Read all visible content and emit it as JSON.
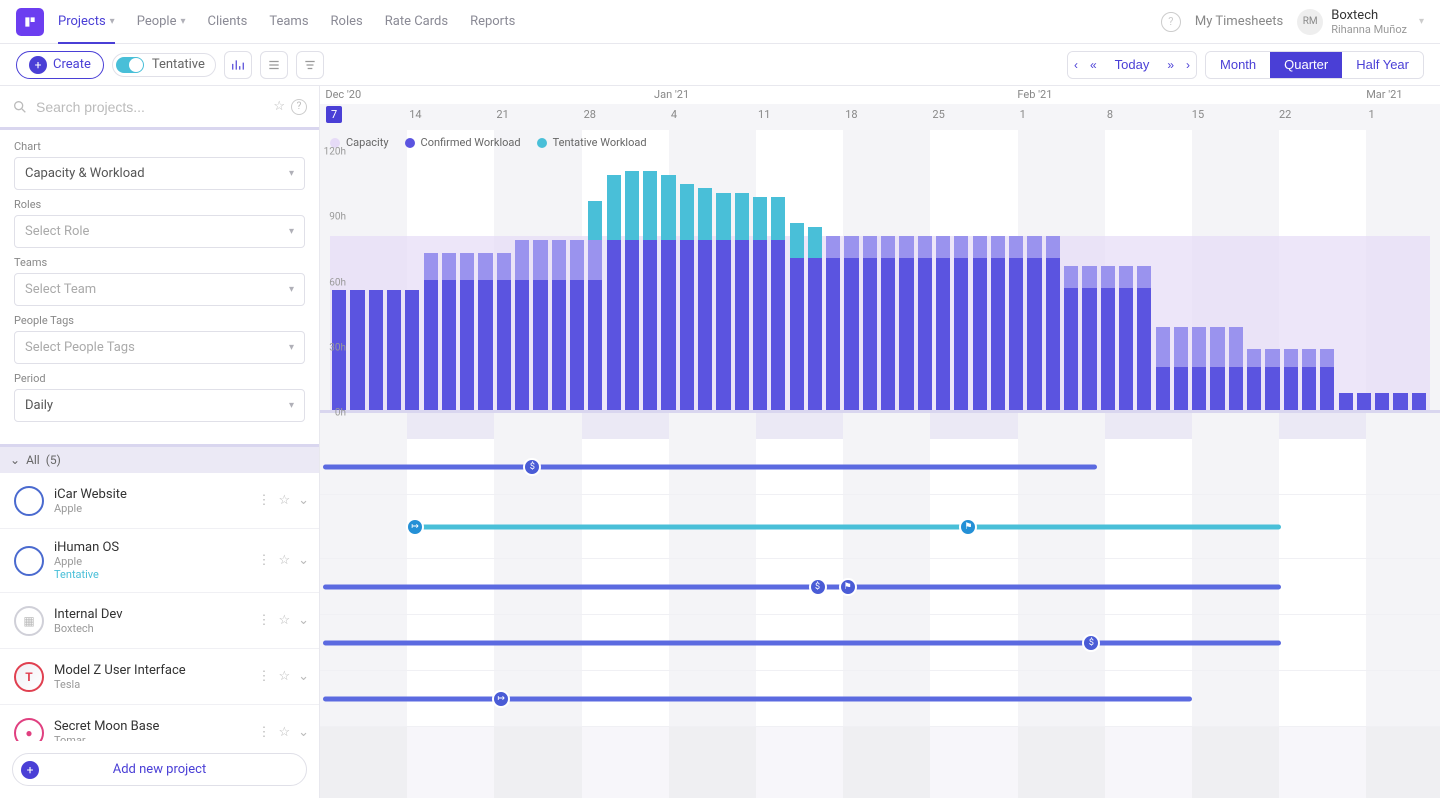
{
  "nav": {
    "tabs": [
      "Projects",
      "People",
      "Clients",
      "Teams",
      "Roles",
      "Rate Cards",
      "Reports"
    ],
    "active": "Projects",
    "my_timesheets": "My Timesheets",
    "company": "Boxtech",
    "user": "Rihanna Muñoz",
    "initials": "RM"
  },
  "toolbar": {
    "create": "Create",
    "tentative": "Tentative",
    "today": "Today",
    "ranges": [
      "Month",
      "Quarter",
      "Half Year"
    ],
    "active_range": "Quarter"
  },
  "search": {
    "placeholder": "Search projects..."
  },
  "filters": {
    "chart_label": "Chart",
    "chart_value": "Capacity & Workload",
    "roles_label": "Roles",
    "roles_placeholder": "Select Role",
    "teams_label": "Teams",
    "teams_placeholder": "Select Team",
    "tags_label": "People Tags",
    "tags_placeholder": "Select People Tags",
    "period_label": "Period",
    "period_value": "Daily"
  },
  "timeline": {
    "months": [
      {
        "label": "Dec '20",
        "pos": 0.003
      },
      {
        "label": "Jan '21",
        "pos": 0.297
      },
      {
        "label": "Feb '21",
        "pos": 0.622
      },
      {
        "label": "Mar '21",
        "pos": 0.934
      }
    ],
    "current_day": "7",
    "ticks": [
      {
        "label": "14",
        "pos": 0.078
      },
      {
        "label": "21",
        "pos": 0.156
      },
      {
        "label": "22",
        "pos": 0.856
      },
      {
        "label": "28",
        "pos": 0.234
      },
      {
        "label": "4",
        "pos": 0.312
      },
      {
        "label": "11",
        "pos": 0.39
      },
      {
        "label": "18",
        "pos": 0.468
      },
      {
        "label": "25",
        "pos": 0.546
      },
      {
        "label": "1",
        "pos": 0.624
      },
      {
        "label": "8",
        "pos": 0.702
      },
      {
        "label": "15",
        "pos": 0.778
      },
      {
        "label": "1",
        "pos": 0.936
      }
    ]
  },
  "legend": {
    "capacity": "Capacity",
    "confirmed": "Confirmed Workload",
    "tentative": "Tentative Workload"
  },
  "chart_data": {
    "type": "bar",
    "ylabel": "",
    "ylim": [
      0,
      120
    ],
    "yticks": [
      "0h",
      "30h",
      "60h",
      "90h",
      "120h"
    ],
    "capacity": 80,
    "colors": {
      "capacity": "#e6dbf7",
      "confirmed": "#5b54e0",
      "tentative": "#49bfd8",
      "tentative_muted": "#9a93ee"
    },
    "bars": [
      {
        "conf": 55,
        "tent": 0,
        "tp": 0
      },
      {
        "conf": 55,
        "tent": 0,
        "tp": 0
      },
      {
        "conf": 55,
        "tent": 0,
        "tp": 0
      },
      {
        "conf": 55,
        "tent": 0,
        "tp": 0
      },
      {
        "conf": 55,
        "tent": 0,
        "tp": 0
      },
      {
        "conf": 60,
        "tent": 0,
        "tp": 12
      },
      {
        "conf": 60,
        "tent": 0,
        "tp": 12
      },
      {
        "conf": 60,
        "tent": 0,
        "tp": 12
      },
      {
        "conf": 60,
        "tent": 0,
        "tp": 12
      },
      {
        "conf": 60,
        "tent": 0,
        "tp": 12
      },
      {
        "conf": 60,
        "tent": 0,
        "tp": 18
      },
      {
        "conf": 60,
        "tent": 0,
        "tp": 18
      },
      {
        "conf": 60,
        "tent": 0,
        "tp": 18
      },
      {
        "conf": 60,
        "tent": 0,
        "tp": 18
      },
      {
        "conf": 60,
        "tent": 18,
        "tp": 18
      },
      {
        "conf": 78,
        "tent": 30,
        "tp": 0
      },
      {
        "conf": 78,
        "tent": 32,
        "tp": 0
      },
      {
        "conf": 78,
        "tent": 32,
        "tp": 0
      },
      {
        "conf": 78,
        "tent": 30,
        "tp": 0
      },
      {
        "conf": 78,
        "tent": 26,
        "tp": 0
      },
      {
        "conf": 78,
        "tent": 24,
        "tp": 0
      },
      {
        "conf": 78,
        "tent": 22,
        "tp": 0
      },
      {
        "conf": 78,
        "tent": 22,
        "tp": 0
      },
      {
        "conf": 78,
        "tent": 20,
        "tp": 0
      },
      {
        "conf": 78,
        "tent": 20,
        "tp": 0
      },
      {
        "conf": 70,
        "tent": 16,
        "tp": 0
      },
      {
        "conf": 70,
        "tent": 14,
        "tp": 0
      },
      {
        "conf": 70,
        "tent": 0,
        "tp": 10
      },
      {
        "conf": 70,
        "tent": 0,
        "tp": 10
      },
      {
        "conf": 70,
        "tent": 0,
        "tp": 10
      },
      {
        "conf": 70,
        "tent": 0,
        "tp": 10
      },
      {
        "conf": 70,
        "tent": 0,
        "tp": 10
      },
      {
        "conf": 70,
        "tent": 0,
        "tp": 10
      },
      {
        "conf": 70,
        "tent": 0,
        "tp": 10
      },
      {
        "conf": 70,
        "tent": 0,
        "tp": 10
      },
      {
        "conf": 70,
        "tent": 0,
        "tp": 10
      },
      {
        "conf": 70,
        "tent": 0,
        "tp": 10
      },
      {
        "conf": 70,
        "tent": 0,
        "tp": 10
      },
      {
        "conf": 70,
        "tent": 0,
        "tp": 10
      },
      {
        "conf": 70,
        "tent": 0,
        "tp": 10
      },
      {
        "conf": 56,
        "tent": 0,
        "tp": 10
      },
      {
        "conf": 56,
        "tent": 0,
        "tp": 10
      },
      {
        "conf": 56,
        "tent": 0,
        "tp": 10
      },
      {
        "conf": 56,
        "tent": 0,
        "tp": 10
      },
      {
        "conf": 56,
        "tent": 0,
        "tp": 10
      },
      {
        "conf": 20,
        "tent": 0,
        "tp": 18
      },
      {
        "conf": 20,
        "tent": 0,
        "tp": 18
      },
      {
        "conf": 20,
        "tent": 0,
        "tp": 18
      },
      {
        "conf": 20,
        "tent": 0,
        "tp": 18
      },
      {
        "conf": 20,
        "tent": 0,
        "tp": 18
      },
      {
        "conf": 20,
        "tent": 0,
        "tp": 8
      },
      {
        "conf": 20,
        "tent": 0,
        "tp": 8
      },
      {
        "conf": 20,
        "tent": 0,
        "tp": 8
      },
      {
        "conf": 20,
        "tent": 0,
        "tp": 8
      },
      {
        "conf": 20,
        "tent": 0,
        "tp": 8
      },
      {
        "conf": 8,
        "tent": 0,
        "tp": 0
      },
      {
        "conf": 8,
        "tent": 0,
        "tp": 0
      },
      {
        "conf": 8,
        "tent": 0,
        "tp": 0
      },
      {
        "conf": 8,
        "tent": 0,
        "tp": 0
      },
      {
        "conf": 8,
        "tent": 0,
        "tp": 0
      }
    ]
  },
  "projects_header": {
    "label": "All",
    "count": "(5)"
  },
  "projects": [
    {
      "name": "iCar Website",
      "client": "Apple",
      "logo": "apple",
      "tentative": false,
      "bar": {
        "type": "conf",
        "start": 0.003,
        "end": 0.695
      },
      "milestones": [
        {
          "icon": "$",
          "pos": 0.19,
          "type": "conf"
        }
      ]
    },
    {
      "name": "iHuman OS",
      "client": "Apple",
      "logo": "apple",
      "tentative": true,
      "bar": {
        "type": "tent",
        "start": 0.085,
        "end": 0.86
      },
      "milestones": [
        {
          "icon": "start",
          "pos": 0.085,
          "type": "tent"
        },
        {
          "icon": "flag",
          "pos": 0.58,
          "type": "tent"
        }
      ]
    },
    {
      "name": "Internal Dev",
      "client": "Boxtech",
      "logo": "internal",
      "tentative": false,
      "bar": {
        "type": "conf",
        "start": 0.003,
        "end": 0.86
      },
      "milestones": [
        {
          "icon": "$",
          "pos": 0.445,
          "type": "conf"
        },
        {
          "icon": "flag",
          "pos": 0.472,
          "type": "conf"
        }
      ]
    },
    {
      "name": "Model Z User Interface",
      "client": "Tesla",
      "logo": "tesla",
      "tentative": false,
      "bar": {
        "type": "conf",
        "start": 0.003,
        "end": 0.86
      },
      "milestones": [
        {
          "icon": "$",
          "pos": 0.69,
          "type": "conf"
        }
      ]
    },
    {
      "name": "Secret Moon Base",
      "client": "Tomar",
      "logo": "pink",
      "tentative": false,
      "bar": {
        "type": "conf",
        "start": 0.003,
        "end": 0.78
      },
      "milestones": [
        {
          "icon": "start",
          "pos": 0.162,
          "type": "conf"
        }
      ]
    }
  ],
  "add_project": "Add new project"
}
